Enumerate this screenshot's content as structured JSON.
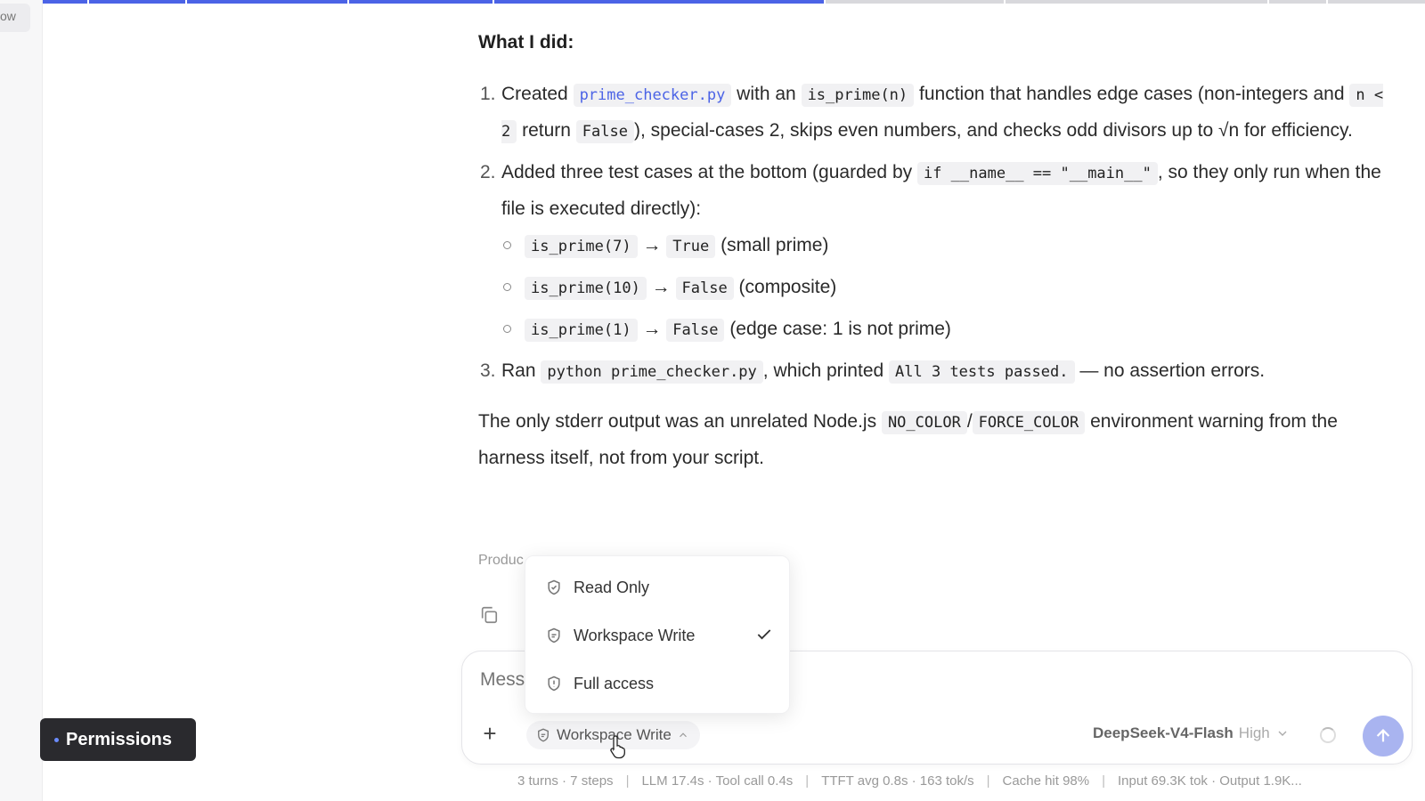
{
  "sidebar": {
    "tab_label": "ow"
  },
  "message": {
    "heading": "What I did:",
    "steps": {
      "s1": {
        "num": "1.",
        "t1": "Created",
        "file": "prime_checker.py",
        "t2": "with an",
        "func": "is_prime(n)",
        "t3": "function that handles edge cases (non-integers and",
        "cond": "n < 2",
        "t4": "return",
        "false": "False",
        "t5": "), special-cases 2, skips even numbers, and checks odd divisors up to √n for efficiency."
      },
      "s2": {
        "num": "2.",
        "t1": "Added three test cases at the bottom (guarded by",
        "guard": "if __name__ == \"__main__\"",
        "t2": ", so they only run when the file is executed directly):",
        "cases": {
          "c1": {
            "call": "is_prime(7)",
            "arrow": "→",
            "result": "True",
            "note": "(small prime)"
          },
          "c2": {
            "call": "is_prime(10)",
            "arrow": "→",
            "result": "False",
            "note": "(composite)"
          },
          "c3": {
            "call": "is_prime(1)",
            "arrow": "→",
            "result": "False",
            "note": "(edge case: 1 is not prime)"
          }
        }
      },
      "s3": {
        "num": "3.",
        "t1": "Ran",
        "cmd": "python prime_checker.py",
        "t2": ", which printed",
        "out": "All 3 tests passed.",
        "t3": "— no assertion errors."
      }
    },
    "closing": {
      "t1": "The only stderr output was an unrelated Node.js",
      "c1": "NO_COLOR",
      "slash": "/",
      "c2": "FORCE_COLOR",
      "t2": "environment warning from the harness itself, not from your script."
    },
    "produced_label": "Produc"
  },
  "permission_menu": {
    "items": {
      "read_only": "Read Only",
      "workspace_write": "Workspace Write",
      "full_access": "Full access"
    },
    "selected": "Workspace Write"
  },
  "composer": {
    "placeholder": "Mess",
    "plus_label": "+",
    "permission_button_label": "Workspace Write",
    "model_name": "DeepSeek-V4-Flash",
    "effort": "High"
  },
  "permissions_pill": {
    "label": "Permissions"
  },
  "footer": {
    "turns": "3 turns · 7 steps",
    "latency": "LLM 17.4s · Tool call 0.4s",
    "ttft": "TTFT avg 0.8s · 163 tok/s",
    "cache": "Cache hit 98%",
    "tokens": "Input 69.3K tok · Output 1.9K...",
    "separator": "|"
  },
  "colors": {
    "accent": "#4b63e6",
    "send_button": "#a9b4f0",
    "pill_bg": "#2a2a2e",
    "code_bg": "#f1f1f3"
  },
  "icons": {
    "copy": "copy-icon",
    "read_only": "shield-check-icon",
    "workspace_write": "shield-edit-icon",
    "full_access": "shield-alert-icon",
    "check": "check-icon",
    "chevron": "chevron-down-icon",
    "send": "arrow-up-icon"
  }
}
